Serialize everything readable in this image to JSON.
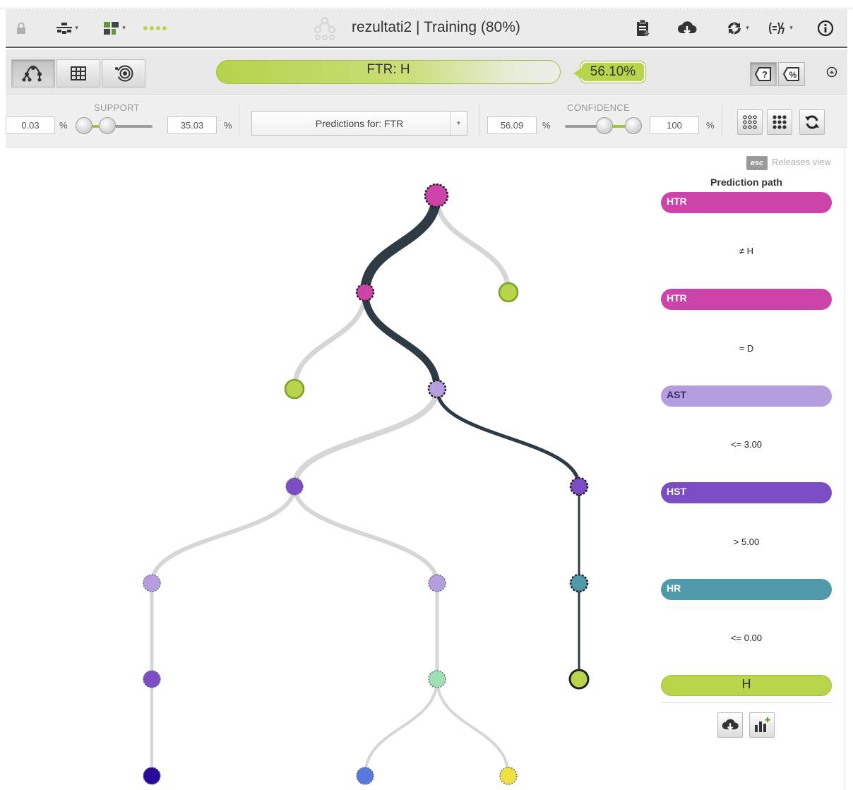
{
  "title_bar": {
    "title": "rezultati2 | Training (80%)",
    "caret": "▾"
  },
  "prediction_bar": {
    "prediction_label": "FTR: H",
    "confidence_value": "56.10%"
  },
  "filters": {
    "support": {
      "label": "SUPPORT",
      "min_value": "0.03",
      "max_value": "35.03",
      "unit": "%"
    },
    "predictions_select": {
      "selected": "Predictions for: FTR"
    },
    "confidence": {
      "label": "CONFIDENCE",
      "min_value": "56.09",
      "max_value": "100",
      "unit": "%"
    }
  },
  "side_panel": {
    "esc_key": "esc",
    "releases_view": "Releases view",
    "title": "Prediction path",
    "steps": [
      {
        "field": "HTR",
        "color": "#cc44aa",
        "condition": "≠ H"
      },
      {
        "field": "HTR",
        "color": "#cc44aa",
        "condition": "= D"
      },
      {
        "field": "AST",
        "color": "#b49ee0",
        "condition": "<= 3.00"
      },
      {
        "field": "HST",
        "color": "#7c4cc4",
        "condition": "> 5.00"
      },
      {
        "field": "HR",
        "color": "#4e9aaa",
        "condition": "<= 0.00"
      }
    ],
    "final_prediction": "H"
  },
  "colors": {
    "accent_green": "#b8d44a",
    "path_dark": "#2e3a44",
    "branch_gray": "#d6d6d6"
  },
  "tree": {
    "nodes": [
      {
        "id": "root",
        "field": "HTR",
        "color": "#cc44aa",
        "on_path": true
      },
      {
        "id": "root-right",
        "field": "leaf",
        "color": "#b8d44a",
        "on_path": false
      },
      {
        "id": "n1",
        "field": "HTR",
        "color": "#cc44aa",
        "on_path": true
      },
      {
        "id": "n1-left",
        "field": "leaf",
        "color": "#b8d44a",
        "on_path": false
      },
      {
        "id": "n2",
        "field": "AST",
        "color": "#b49ee0",
        "on_path": true
      },
      {
        "id": "n3-left",
        "field": "HST",
        "color": "#7c4cc4",
        "on_path": false
      },
      {
        "id": "n3",
        "field": "HST",
        "color": "#7c4cc4",
        "on_path": true
      },
      {
        "id": "n4-a",
        "field": "AST",
        "color": "#b49ee0",
        "on_path": false
      },
      {
        "id": "n4-b",
        "field": "AST",
        "color": "#b49ee0",
        "on_path": false
      },
      {
        "id": "n4",
        "field": "HR",
        "color": "#4e9aaa",
        "on_path": true
      },
      {
        "id": "n5-a",
        "field": "HST",
        "color": "#7c4cc4",
        "on_path": false
      },
      {
        "id": "n5-b",
        "field": "node",
        "color": "#9ee0b4",
        "on_path": false
      },
      {
        "id": "leaf-final",
        "field": "leaf",
        "color": "#b8d44a",
        "on_path": true
      },
      {
        "id": "n6-a",
        "field": "node",
        "color": "#2a0a9a",
        "on_path": false
      },
      {
        "id": "n6-b",
        "field": "node",
        "color": "#5878de",
        "on_path": false
      },
      {
        "id": "n6-c",
        "field": "node",
        "color": "#eee040",
        "on_path": false
      }
    ]
  }
}
